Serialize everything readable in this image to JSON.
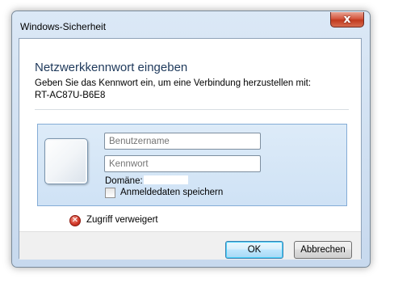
{
  "window": {
    "title": "Windows-Sicherheit",
    "close_glyph": "x"
  },
  "dialog": {
    "heading": "Netzwerkkennwort eingeben",
    "description": "Geben Sie das Kennwort ein, um eine Verbindung herzustellen mit:",
    "target": "RT-AC87U-B6E8"
  },
  "credentials": {
    "username_placeholder": "Benutzername",
    "password_placeholder": "Kennwort",
    "domain_label": "Domäne:",
    "remember_label": "Anmeldedaten speichern",
    "remember_checked": false,
    "icon": "user-tile-icon"
  },
  "error": {
    "icon": "error-icon",
    "message": "Zugriff verweigert",
    "color": "#d33b2c"
  },
  "buttons": {
    "ok": "OK",
    "cancel": "Abbrechen"
  },
  "colors": {
    "heading": "#1e395b",
    "tile_background": "#d8e8f8",
    "tile_border": "#84acd6"
  }
}
